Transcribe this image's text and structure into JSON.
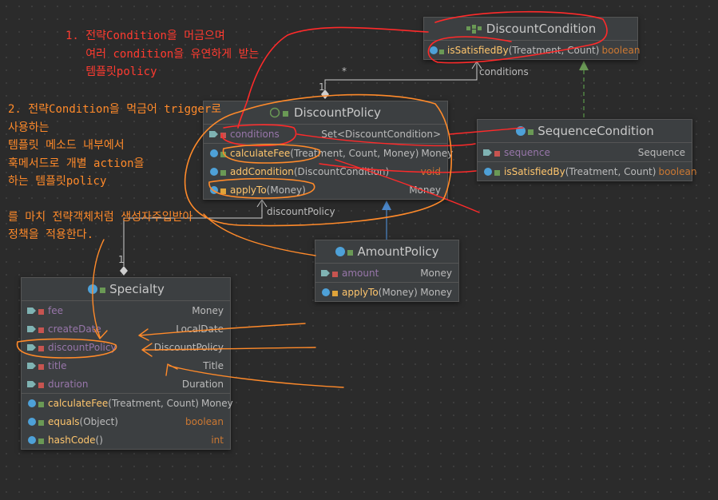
{
  "notes": {
    "red": [
      "1. 전략Condition을 머금으며",
      "   여러 condition을 유연하게 받는",
      "   템플릿policy"
    ],
    "orange": [
      "2. 전략Condition을 먹금어 trigger로",
      "사용하는",
      "템플릿 메소드 내부에서",
      "훅메서드로 개별 action을",
      "하는 템플릿policy",
      "",
      "를 마치 전략객체처럼 생성자주입받아",
      "정책을 적용한다."
    ]
  },
  "labels": {
    "star": "*",
    "one_a": "1",
    "one_b": "1",
    "conditions": "conditions",
    "discountPolicy": "discountPolicy"
  },
  "classes": {
    "discount_condition": {
      "title": "DiscountCondition",
      "methods": [
        {
          "name": "isSatisfiedBy",
          "params": "(Treatment, Count)",
          "type": "boolean"
        }
      ]
    },
    "discount_policy": {
      "title": "DiscountPolicy",
      "fields": [
        {
          "name": "conditions",
          "type": "Set<DiscountCondition>"
        }
      ],
      "methods": [
        {
          "name": "calculateFee",
          "params": "(Treatment, Count, Money)",
          "type": "Money"
        },
        {
          "name": "addCondition",
          "params": "(DiscountCondition)",
          "type": "void"
        },
        {
          "name": "applyTo",
          "params": "(Money)",
          "type": "Money"
        }
      ]
    },
    "sequence_condition": {
      "title": "SequenceCondition",
      "fields": [
        {
          "name": "sequence",
          "type": "Sequence"
        }
      ],
      "methods": [
        {
          "name": "isSatisfiedBy",
          "params": "(Treatment, Count)",
          "type": "boolean"
        }
      ]
    },
    "amount_policy": {
      "title": "AmountPolicy",
      "fields": [
        {
          "name": "amount",
          "type": "Money"
        }
      ],
      "methods": [
        {
          "name": "applyTo",
          "params": "(Money)",
          "type": "Money"
        }
      ]
    },
    "specialty": {
      "title": "Specialty",
      "fields": [
        {
          "name": "fee",
          "type": "Money"
        },
        {
          "name": "createDate",
          "type": "LocalDate"
        },
        {
          "name": "discountPolicy",
          "type": "DiscountPolicy"
        },
        {
          "name": "title",
          "type": "Title"
        },
        {
          "name": "duration",
          "type": "Duration"
        }
      ],
      "methods": [
        {
          "name": "calculateFee",
          "params": "(Treatment, Count)",
          "type": "Money"
        },
        {
          "name": "equals",
          "params": "(Object)",
          "type": "boolean"
        },
        {
          "name": "hashCode",
          "params": "()",
          "type": "int"
        }
      ]
    }
  },
  "colors": {
    "red_ink": "#ff3b30",
    "orange_ink": "#ff8a2a",
    "field": "#9876aa",
    "method": "#ffc66d",
    "keyword": "#cc7832"
  }
}
